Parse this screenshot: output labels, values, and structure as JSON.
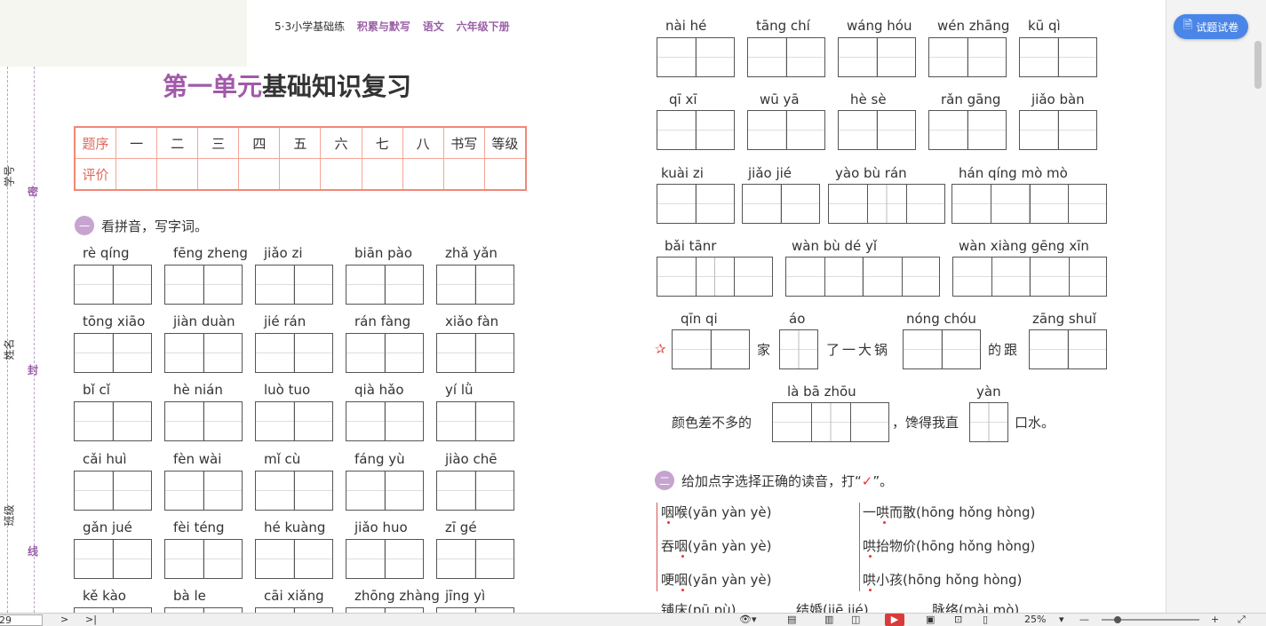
{
  "header": {
    "series": "5·3小学基础练",
    "sub1": "积累与默写",
    "subject": "语文",
    "grade": "六年级下册"
  },
  "margin": {
    "labels": [
      "学号",
      "姓名",
      "班级"
    ],
    "seals": [
      "密",
      "封",
      "线"
    ]
  },
  "title": {
    "part1": "第一单元",
    "part2": "基础知识复习"
  },
  "score_table": {
    "row1": [
      "题序",
      "一",
      "二",
      "三",
      "四",
      "五",
      "六",
      "七",
      "八",
      "书写",
      "等级"
    ],
    "row2_label": "评价"
  },
  "section1": {
    "badge": "一",
    "title": "看拼音，写字词。"
  },
  "left_pinyin": [
    [
      "rè qíng",
      "fēng zheng",
      "jiǎo zi",
      "biān pào",
      "zhǎ yǎn"
    ],
    [
      "tōng xiāo",
      "jiàn duàn",
      "jié rán",
      "rán fàng",
      "xiǎo fàn"
    ],
    [
      "bǐ cǐ",
      "hè nián",
      "luò tuo",
      "qià hǎo",
      "yí lǜ"
    ],
    [
      "cǎi huì",
      "fèn wài",
      "mǐ cù",
      "fáng yù",
      "jiào chē"
    ],
    [
      "gǎn jué",
      "fèi téng",
      "hé kuàng",
      "jiǎo huo",
      "zī gé"
    ],
    [
      "kě kào",
      "bà le",
      "cāi xiǎng",
      "zhōng zhàng",
      "jīng yì"
    ]
  ],
  "right_pinyin_row1": [
    "nài hé",
    "tāng chí",
    "wáng hóu",
    "wén zhāng",
    "kū qì"
  ],
  "right_pinyin_row2": [
    "qī xī",
    "wū yā",
    "hè sè",
    "rǎn gāng",
    "jiǎo bàn"
  ],
  "right_pinyin_row3": [
    "kuài zi",
    "jiǎo jié",
    "yào bù rán",
    "hán qíng mò mò"
  ],
  "right_pinyin_row4": [
    "bǎi tānr",
    "wàn bù dé yǐ",
    "wàn xiàng gēng xīn"
  ],
  "sentence": {
    "py1": "qīn qi",
    "py2": "áo",
    "py3": "nóng chóu",
    "py4": "zāng shuǐ",
    "t1": "家",
    "t2": "了一大锅",
    "t3": "的跟",
    "py5": "là bā zhōu",
    "py6": "yàn",
    "t4": "颜色差不多的",
    "t5": "，馋得我直",
    "t6": "口水。"
  },
  "section2": {
    "badge": "二",
    "title_pre": "给加点字选择正确的读音，打“",
    "title_post": "”。",
    "mark": "✓"
  },
  "readings_left": [
    "咽喉(yān  yàn  yè)",
    "吞咽(yān  yàn  yè)",
    "哽咽(yān  yàn  yè)"
  ],
  "readings_right": [
    "一哄而散(hōng  hǒng  hòng)",
    "哄抬物价(hōng  hǒng  hòng)",
    "哄小孩(hōng  hǒng  hòng)"
  ],
  "readings_bottom": [
    "铺床(pū  pù)",
    "结婚(jiē  jié)",
    "脉络(mài  mò)"
  ],
  "right_panel": {
    "button": "试题试卷"
  },
  "bottom_bar": {
    "page": "29",
    "next": ">",
    "last": ">|",
    "zoom": "25%",
    "zoom_arrow": "▾",
    "minus": "—",
    "plus": "+"
  }
}
